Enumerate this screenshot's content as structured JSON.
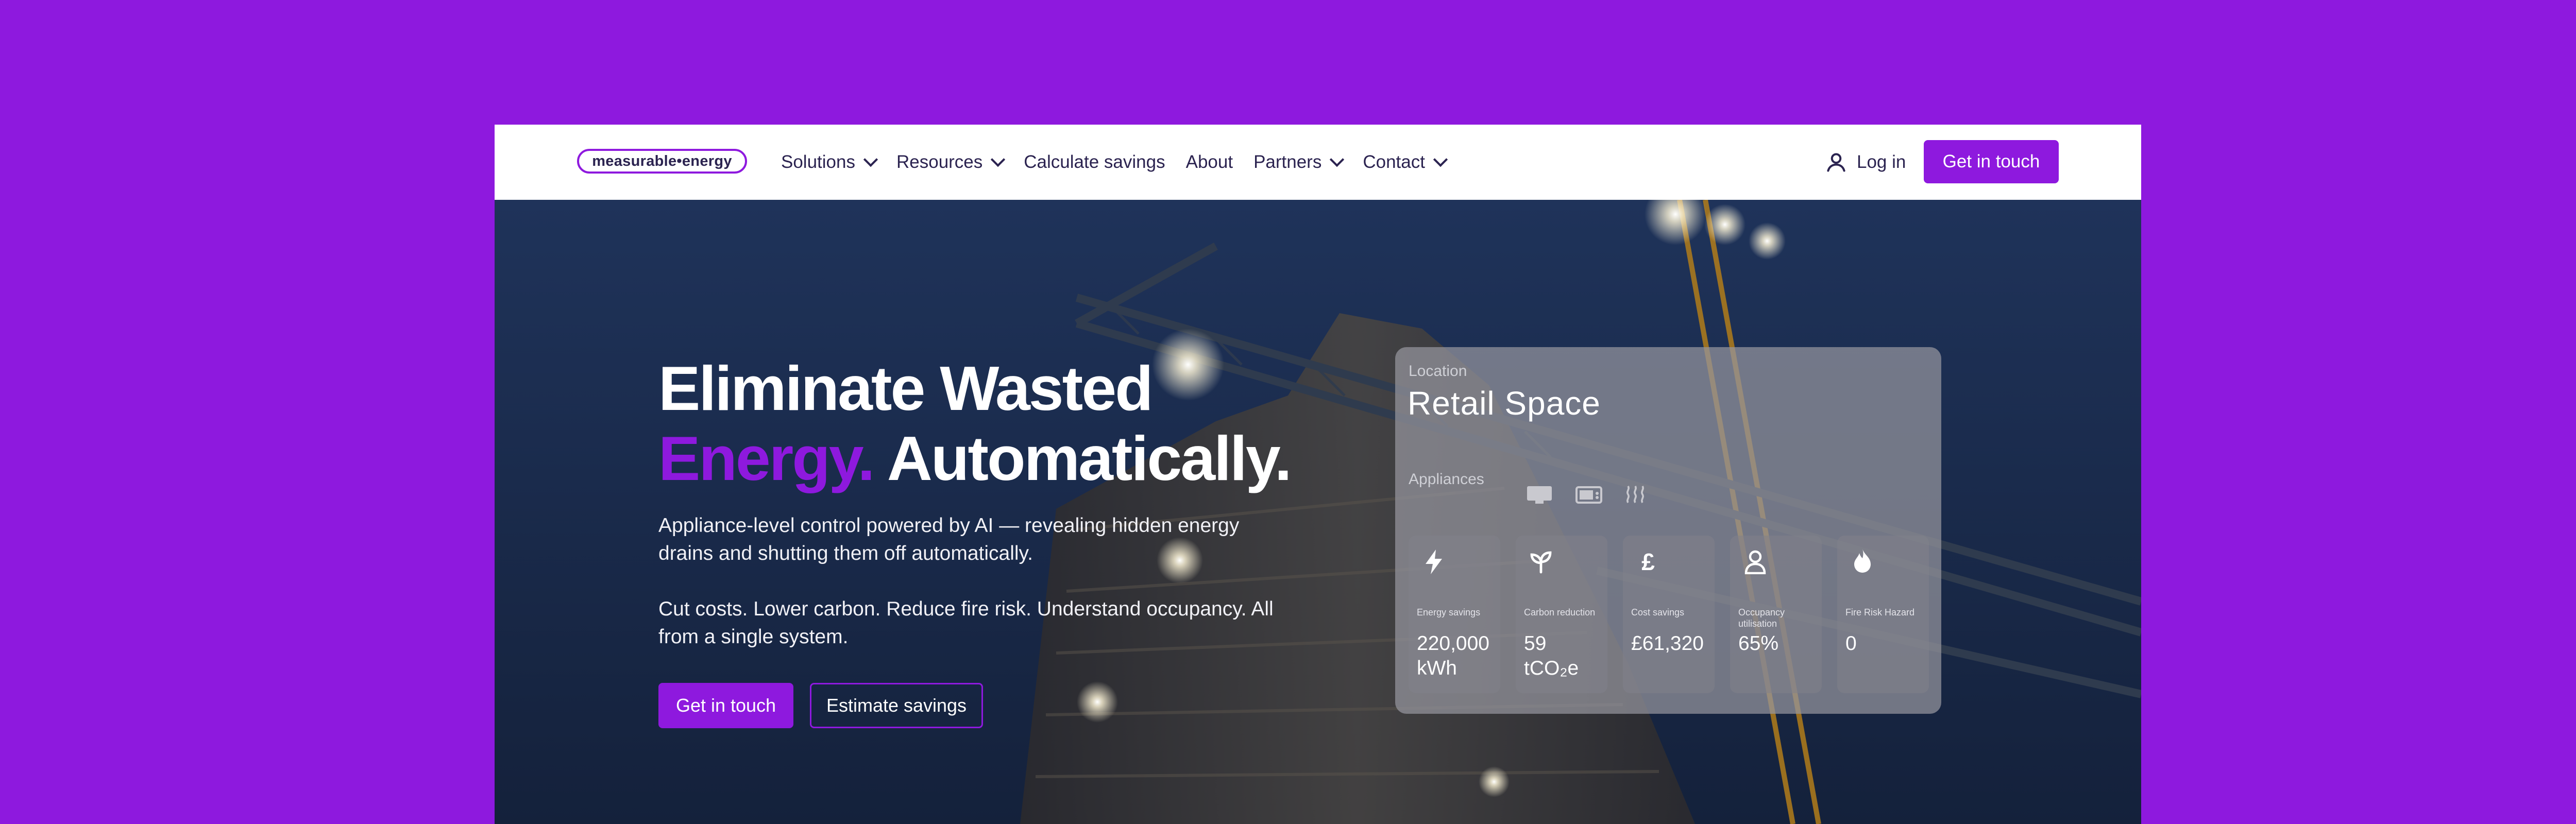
{
  "nav": {
    "logo": "measurable•energy",
    "items": [
      {
        "label": "Solutions",
        "dropdown": true
      },
      {
        "label": "Resources",
        "dropdown": true
      },
      {
        "label": "Calculate savings",
        "dropdown": false
      },
      {
        "label": "About",
        "dropdown": false
      },
      {
        "label": "Partners",
        "dropdown": true
      },
      {
        "label": "Contact",
        "dropdown": true
      }
    ],
    "login": "Log in",
    "cta": "Get in touch"
  },
  "hero": {
    "headline_line1": "Eliminate Wasted",
    "headline_accent": "Energy.",
    "headline_line2_rest": " Automatically.",
    "paragraph1": "Appliance-level control powered by AI — revealing hidden energy drains and shutting them off automatically.",
    "paragraph2": "Cut costs. Lower carbon. Reduce fire risk. Understand occupancy. All from a single system.",
    "primary_button": "Get in touch",
    "secondary_button": "Estimate savings"
  },
  "card": {
    "location_label": "Location",
    "location_value": "Retail Space",
    "appliances_label": "Appliances",
    "appliance_icons": [
      "monitor-icon",
      "microwave-icon",
      "heater-icon"
    ],
    "metrics": [
      {
        "name": "Energy savings",
        "value": "220,000 kWh",
        "icon": "lightning-icon"
      },
      {
        "name": "Carbon reduction",
        "value": "59 tCO₂e",
        "icon": "leaf-icon"
      },
      {
        "name": "Cost savings",
        "value": "£61,320",
        "icon": "pound-icon"
      },
      {
        "name": "Occupancy utilisation",
        "value": "65%",
        "icon": "person-icon"
      },
      {
        "name": "Fire Risk Hazard",
        "value": "0",
        "icon": "flame-icon"
      }
    ]
  },
  "colors": {
    "brand": "#8e19de",
    "text_dark": "#2b2350",
    "hero_bg": "#1b2b4c"
  }
}
